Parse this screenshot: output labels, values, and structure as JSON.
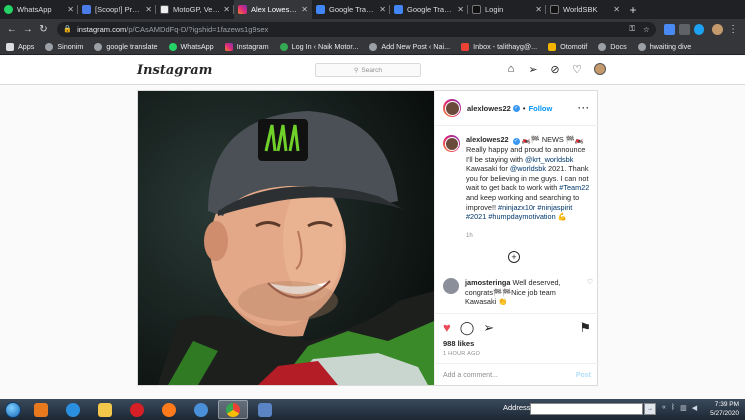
{
  "browser": {
    "tabs": [
      {
        "title": "WhatsApp",
        "color": "#25d366",
        "active": false
      },
      {
        "title": "[Scoop!] Protor",
        "color": "#4a7de8",
        "active": false
      },
      {
        "title": "MotoGP, Verge",
        "color": "#222222",
        "active": false
      },
      {
        "title": "Alex Lowes on",
        "color": "#d6249f",
        "active": true
      },
      {
        "title": "Google Transla",
        "color": "#4285f4",
        "active": false
      },
      {
        "title": "Google Transla",
        "color": "#4285f4",
        "active": false
      },
      {
        "title": "Login",
        "color": "#111111",
        "active": false
      },
      {
        "title": "WorldSBK",
        "color": "#111111",
        "active": false
      }
    ],
    "url_host": "instagram.com",
    "url_path": "/p/CAsAMDdFq-D/?igshid=1fazews1g9sex",
    "bookmarks": [
      {
        "label": "Apps",
        "color": "#dadce0"
      },
      {
        "label": "Sinonim",
        "color": "#9aa0a6"
      },
      {
        "label": "google translate",
        "color": "#9aa0a6"
      },
      {
        "label": "WhatsApp",
        "color": "#25d366"
      },
      {
        "label": "Instagram",
        "color": "#d6249f"
      },
      {
        "label": "Log In ‹ Naik Motor...",
        "color": "#9aa0a6"
      },
      {
        "label": "Add New Post ‹ Nai...",
        "color": "#9aa0a6"
      },
      {
        "label": "Inbox - talithayg@...",
        "color": "#ea4335"
      },
      {
        "label": "Otomotif",
        "color": "#f4b400"
      },
      {
        "label": "Docs",
        "color": "#9aa0a6"
      },
      {
        "label": "hwaiting dive",
        "color": "#9aa0a6"
      }
    ]
  },
  "instagram": {
    "logo": "Instagram",
    "search_placeholder": "Search"
  },
  "post": {
    "username": "alexlowes22",
    "follow_label": "Follow",
    "caption_user": "alexlowes22",
    "caption_line1": "🏍️🏁 NEWS 🏁🏍️",
    "caption_text1": "Really happy and proud to announce I'll be staying with",
    "caption_mention1": "@krt_worldsbk",
    "caption_text2": "Kawasaki for",
    "caption_mention2": "@worldsbk",
    "caption_text3": "2021. Thank you for believing in me guys. I can not wait to get back to work with",
    "caption_tag1": "#Team22",
    "caption_text4": "and keep working and searching to improve!!",
    "caption_tag2": "#ninjazx10r",
    "caption_tag3": "#ninjaspirit",
    "caption_tag4": "#2021",
    "caption_tag5": "#humpdaymotivation",
    "caption_end": "💪",
    "caption_time": "1h",
    "comment_user": "jamosteringa",
    "comment_text": "Well deserved, congrats🏁🏁Nice job team Kawasaki 👏",
    "likes": "988 likes",
    "posted_ago": "1 HOUR AGO",
    "add_comment_placeholder": "Add a comment...",
    "post_button": "Post"
  },
  "taskbar": {
    "address_label": "Address",
    "time": "7:39 PM",
    "date": "5/27/2020"
  }
}
